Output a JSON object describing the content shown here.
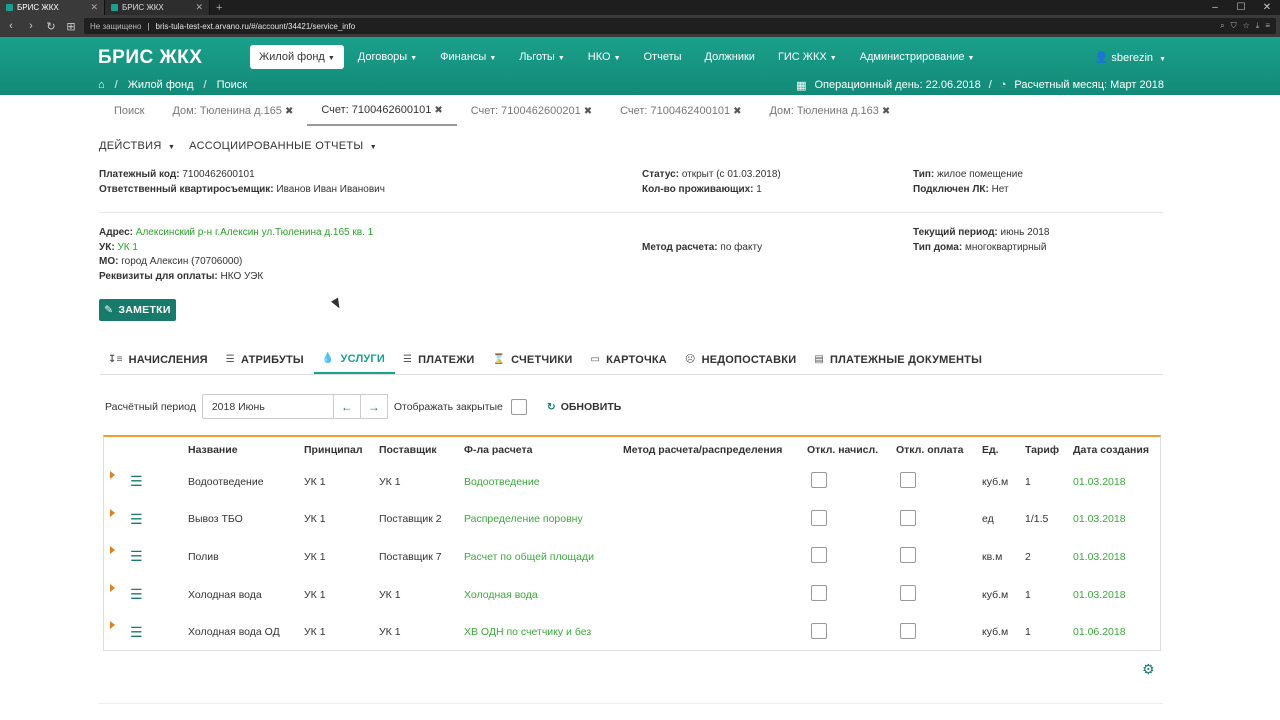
{
  "browser": {
    "tabs": [
      {
        "title": "БРИС ЖКХ",
        "active": true
      },
      {
        "title": "БРИС ЖКХ",
        "active": false
      }
    ],
    "new_tab": "+",
    "security": "Не защищено",
    "url": "bris-tula-test-ext.arvano.ru/#/account/34421/service_info"
  },
  "app": {
    "brand": "БРИС ЖКХ",
    "nav": [
      {
        "label": "Жилой фонд",
        "dropdown": true,
        "active": true
      },
      {
        "label": "Договоры",
        "dropdown": true
      },
      {
        "label": "Финансы",
        "dropdown": true
      },
      {
        "label": "Льготы",
        "dropdown": true
      },
      {
        "label": "НКО",
        "dropdown": true
      },
      {
        "label": "Отчеты",
        "dropdown": false
      },
      {
        "label": "Должники",
        "dropdown": false
      },
      {
        "label": "ГИС ЖКХ",
        "dropdown": true
      },
      {
        "label": "Администрирование",
        "dropdown": true
      }
    ],
    "user": "sberezin",
    "breadcrumbs": [
      "Жилой фонд",
      "Поиск"
    ],
    "op_day_label": "Операционный день: 22.06.2018",
    "calc_month_label": "Расчетный месяц: Март 2018"
  },
  "search_tabs": [
    {
      "label": "Поиск",
      "closable": false,
      "active": false
    },
    {
      "label": "Дом: Тюленина д.165",
      "closable": true,
      "active": false
    },
    {
      "label": "Счет: 7100462600101",
      "closable": true,
      "active": true
    },
    {
      "label": "Счет: 7100462600201",
      "closable": true,
      "active": false
    },
    {
      "label": "Счет: 7100462400101",
      "closable": true,
      "active": false
    },
    {
      "label": "Дом: Тюленина д.163",
      "closable": true,
      "active": false
    }
  ],
  "actions": {
    "actions": "ДЕЙСТВИЯ",
    "reports": "АССОЦИИРОВАННЫЕ ОТЧЕТЫ"
  },
  "account": {
    "pay_code_label": "Платежный код:",
    "pay_code": "7100462600101",
    "tenant_label": "Ответственный квартиросъемщик:",
    "tenant": "Иванов Иван Иванович",
    "status_label": "Статус:",
    "status": "открыт (с 01.03.2018)",
    "residents_label": "Кол-во проживающих:",
    "residents": "1",
    "type_label": "Тип:",
    "type": "жилое помещение",
    "lk_label": "Подключен ЛК:",
    "lk": "Нет",
    "address_label": "Адрес:",
    "address": "Алексинский р-н г.Алексин ул.Тюленина д.165 кв. 1",
    "uk_label": "УК:",
    "uk": "УК 1",
    "mo_label": "МО:",
    "mo": "город Алексин (70706000)",
    "req_label": "Реквизиты для оплаты:",
    "req": "НКО УЭК",
    "calc_method_label": "Метод расчета:",
    "calc_method": "по факту",
    "period_label": "Текущий период:",
    "period": "июнь 2018",
    "house_type_label": "Тип дома:",
    "house_type": "многоквартирный"
  },
  "notes_button": "ЗАМЕТКИ",
  "sub_tabs": [
    {
      "label": "НАЧИСЛЕНИЯ",
      "icon": "sort-icon"
    },
    {
      "label": "АТРИБУТЫ",
      "icon": "sliders-icon"
    },
    {
      "label": "УСЛУГИ",
      "icon": "drop-icon",
      "active": true
    },
    {
      "label": "ПЛАТЕЖИ",
      "icon": "database-icon"
    },
    {
      "label": "СЧЕТЧИКИ",
      "icon": "hourglass-icon"
    },
    {
      "label": "КАРТОЧКА",
      "icon": "card-icon"
    },
    {
      "label": "НЕДОПОСТАВКИ",
      "icon": "frown-icon"
    },
    {
      "label": "ПЛАТЕЖНЫЕ ДОКУМЕНТЫ",
      "icon": "document-icon"
    }
  ],
  "filter": {
    "period_label": "Расчётный период",
    "period_value": "2018 Июнь",
    "show_closed": "Отображать закрытые",
    "refresh": "ОБНОВИТЬ"
  },
  "table": {
    "headers": [
      "Название",
      "Принципал",
      "Поставщик",
      "Ф-ла расчета",
      "Метод расчета/распределения",
      "Откл. начисл.",
      "Откл. оплата",
      "Ед.",
      "Тариф",
      "Дата создания"
    ],
    "rows": [
      [
        "Водоотведение",
        "УК 1",
        "УК 1",
        "Водоотведение",
        "",
        "",
        "",
        "куб.м",
        "1",
        "01.03.2018"
      ],
      [
        "Вывоз ТБО",
        "УК 1",
        "Поставщик 2",
        "Распределение поровну",
        "",
        "",
        "",
        "ед",
        "1/1.5",
        "01.03.2018"
      ],
      [
        "Полив",
        "УК 1",
        "Поставщик 7",
        "Расчет по общей площади",
        "",
        "",
        "",
        "кв.м",
        "2",
        "01.03.2018"
      ],
      [
        "Холодная вода",
        "УК 1",
        "УК 1",
        "Холодная вода",
        "",
        "",
        "",
        "куб.м",
        "1",
        "01.03.2018"
      ],
      [
        "Холодная вода ОД",
        "УК 1",
        "УК 1",
        "ХВ ОДН по счетчику и без",
        "",
        "",
        "",
        "куб.м",
        "1",
        "01.06.2018"
      ]
    ]
  }
}
